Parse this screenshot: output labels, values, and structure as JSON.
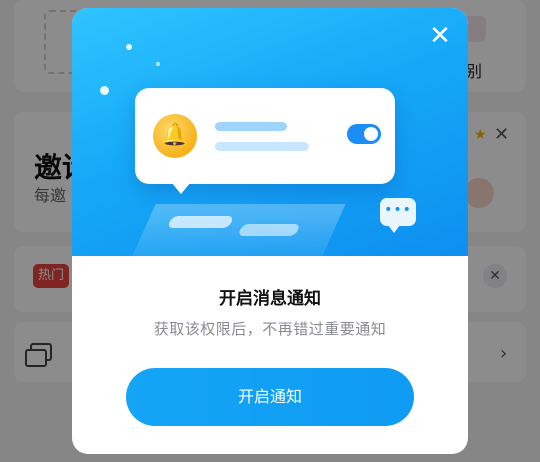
{
  "background": {
    "ocr_label": "识别",
    "invite_title": "邀请",
    "invite_subtitle": "每邀",
    "hot_badge": "热门"
  },
  "modal": {
    "close_label": "✕",
    "title": "开启消息通知",
    "subtitle": "获取该权限后，不再错过重要通知",
    "button_label": "开启通知"
  },
  "illustration": {
    "bell_icon": "bell-icon",
    "chat_dots": "•••"
  },
  "colors": {
    "accent": "#14a5f5",
    "bell": "#f6b21a",
    "hot": "#e8423b"
  }
}
